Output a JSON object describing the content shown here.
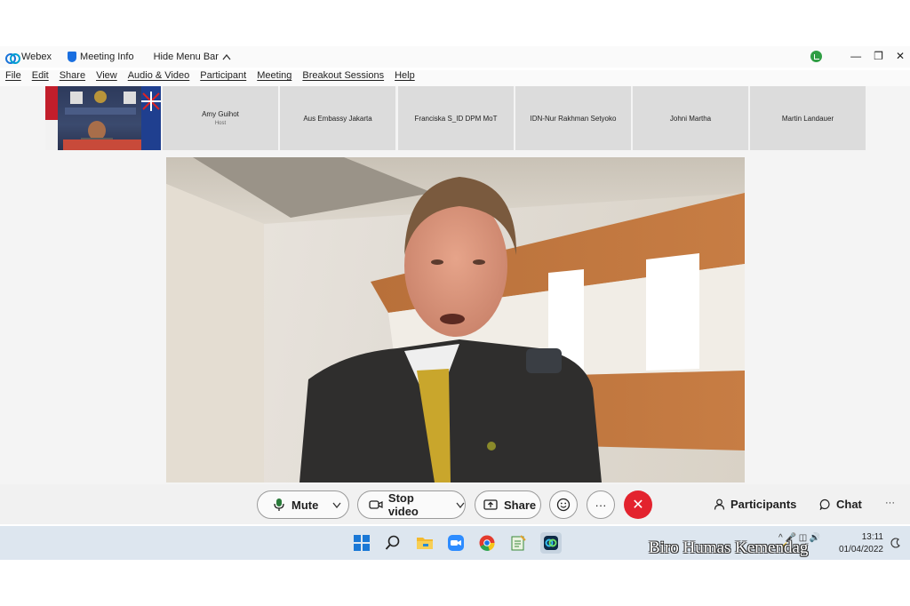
{
  "titlebar": {
    "app_name": "Webex",
    "meeting_info": "Meeting Info",
    "hide_menu": "Hide Menu Bar",
    "minimize": "—",
    "restore": "❐",
    "close": "✕",
    "chevron": "^"
  },
  "menu": [
    "File",
    "Edit",
    "Share",
    "View",
    "Audio & Video",
    "Participant",
    "Meeting",
    "Breakout Sessions",
    "Help"
  ],
  "participants": [
    {
      "name": "Amy Guihot",
      "role": "Host"
    },
    {
      "name": "Aus Embassy Jakarta",
      "role": ""
    },
    {
      "name": "Franciska S_ID DPM MoT",
      "role": ""
    },
    {
      "name": "IDN-Nur Rakhman Setyoko",
      "role": ""
    },
    {
      "name": "Johni Martha",
      "role": ""
    },
    {
      "name": "Martin Landauer",
      "role": ""
    }
  ],
  "controls": {
    "mute": "Mute",
    "stop_video": "Stop video",
    "share": "Share",
    "more": "···",
    "participants": "Participants",
    "chat": "Chat",
    "overflow": "···"
  },
  "taskbar": {
    "time": "13:11",
    "date": "01/04/2022"
  },
  "watermark": "Biro Humas Kemendag",
  "colors": {
    "end_call": "#e3232e",
    "webex_blue": "#1a74d9",
    "taskbar": "#dde6ef"
  }
}
